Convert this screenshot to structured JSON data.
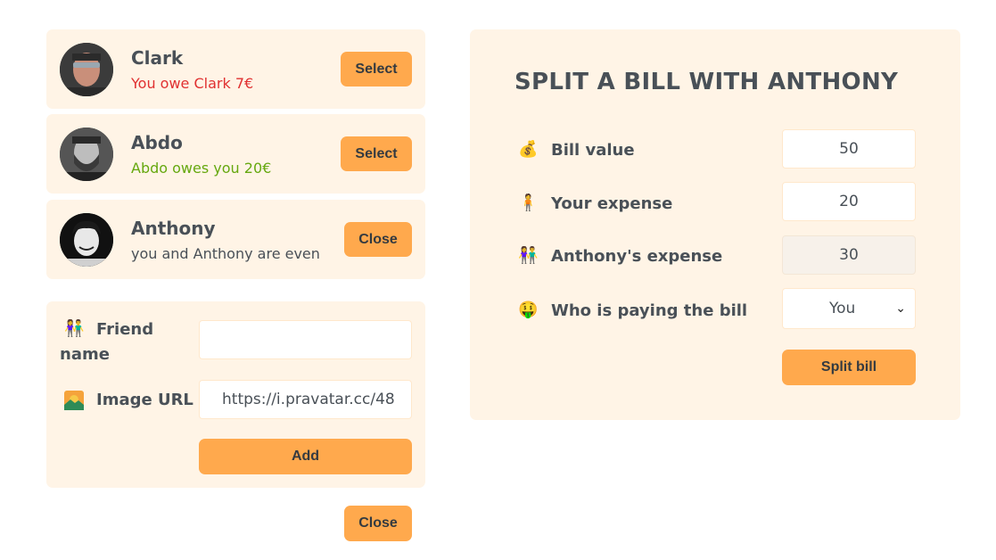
{
  "friends": [
    {
      "name": "Clark",
      "status": "You owe Clark 7€",
      "status_tone": "owe",
      "button": "Select",
      "avatar_icon": "avatar-photo"
    },
    {
      "name": "Abdo",
      "status": "Abdo owes you 20€",
      "status_tone": "owed",
      "button": "Select",
      "avatar_icon": "avatar-photo"
    },
    {
      "name": "Anthony",
      "status": "you and Anthony are even",
      "status_tone": "even",
      "button": "Close",
      "avatar_icon": "avatar-photo"
    }
  ],
  "add_friend": {
    "name_emoji": "👫",
    "name_label_line1": "Friend",
    "name_label_line2": "name",
    "name_value": "",
    "image_emoji": "🌄",
    "image_label": "Image URL",
    "image_value": "https://i.pravatar.cc/48",
    "add_label": "Add"
  },
  "close_label": "Close",
  "split": {
    "title": "SPLIT A BILL WITH ANTHONY",
    "bill_emoji": "💰",
    "bill_label": "Bill value",
    "bill_value": "50",
    "your_emoji": "🧍",
    "your_label": "Your expense",
    "your_value": "20",
    "friend_emoji": "👫",
    "friend_label": "Anthony's expense",
    "friend_value": "30",
    "payer_emoji": "🤑",
    "payer_label": "Who is paying the bill",
    "payer_value": "You",
    "submit_label": "Split bill"
  },
  "colors": {
    "accent": "#ffa94d",
    "panel": "#fff4e6",
    "owe": "#e03131",
    "owed": "#66a80f",
    "text": "#495057"
  }
}
